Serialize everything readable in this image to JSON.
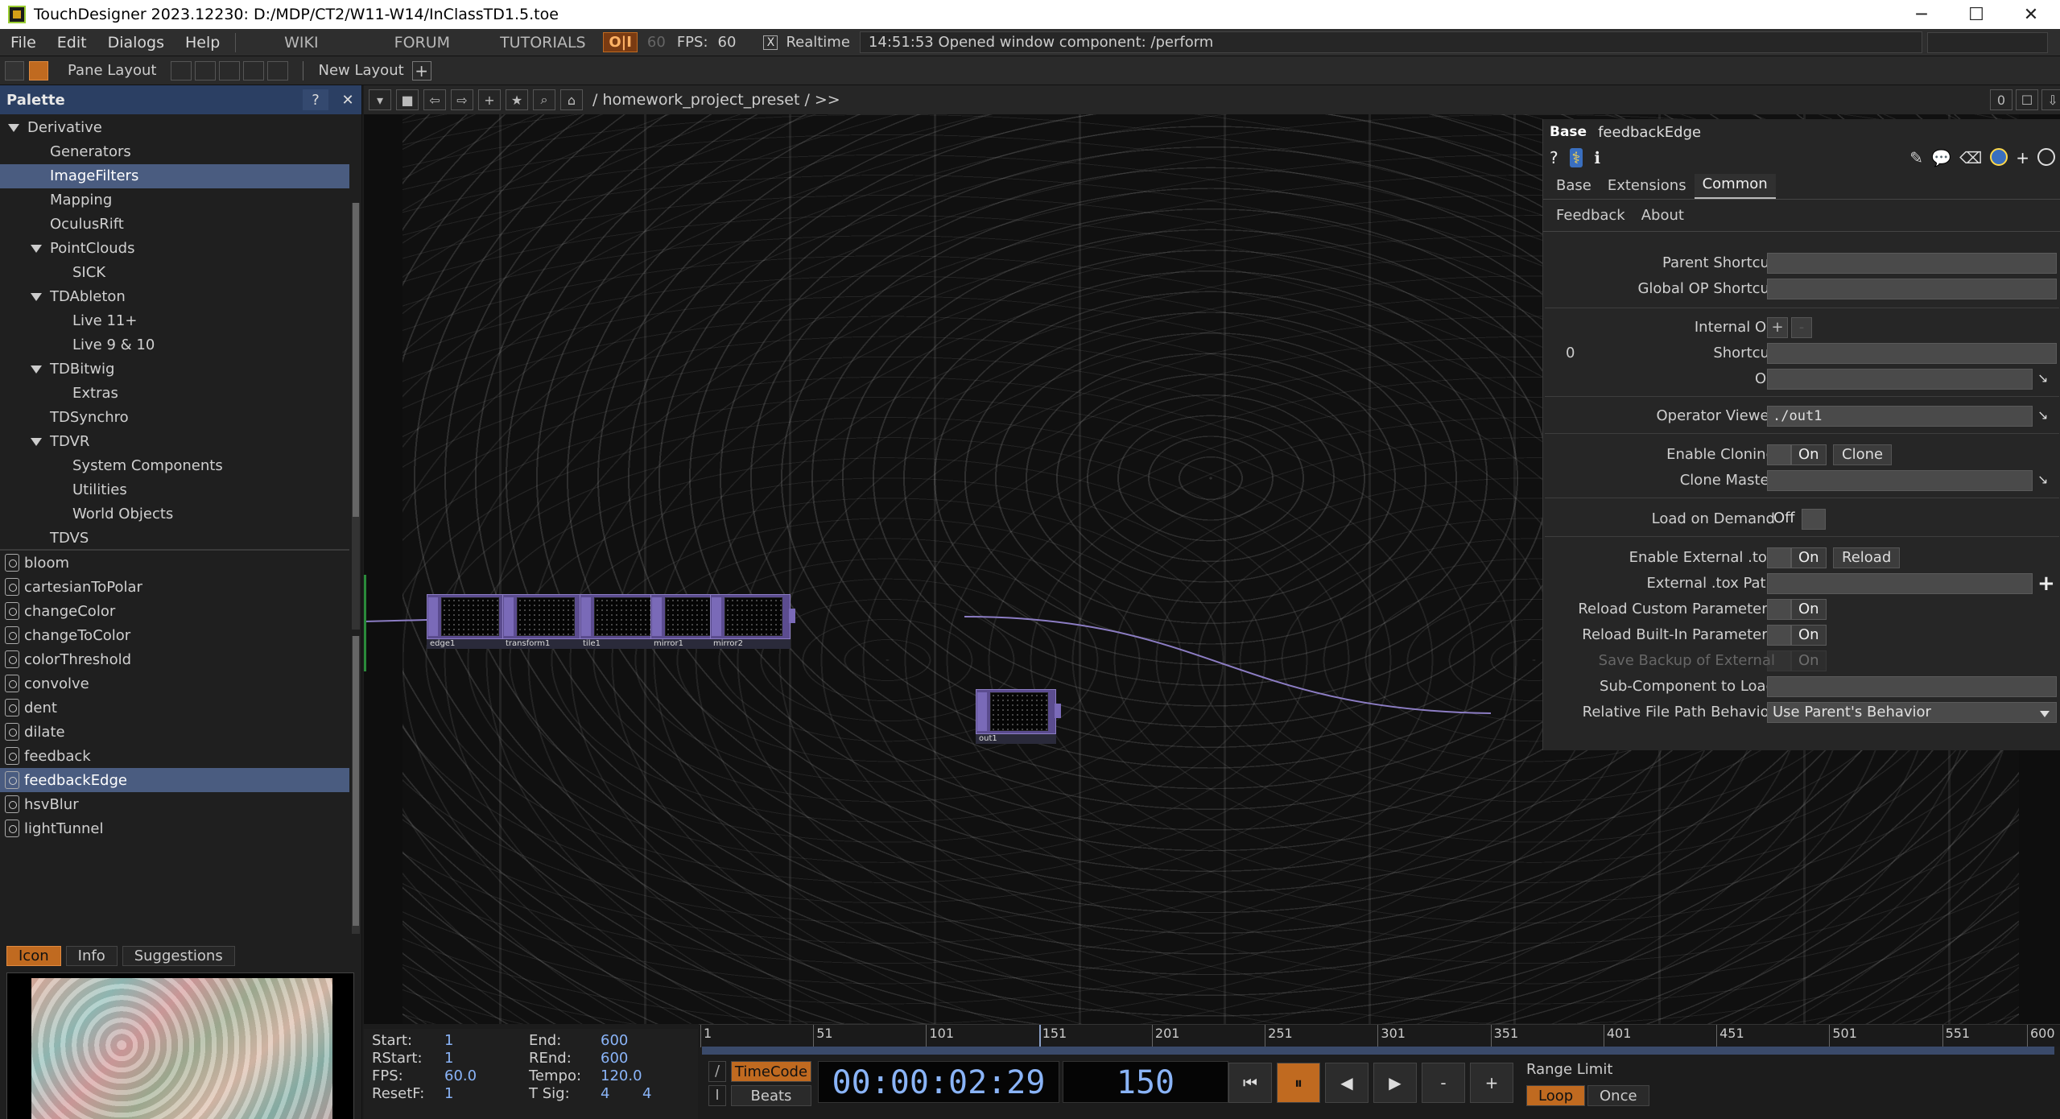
{
  "window": {
    "title": "TouchDesigner 2023.12230: D:/MDP/CT2/W11-W14/InClassTD1.5.toe",
    "minimize": "─",
    "maximize": "☐",
    "close": "✕"
  },
  "menubar": {
    "menus": [
      "File",
      "Edit",
      "Dialogs",
      "Help"
    ],
    "nav": [
      "WIKI",
      "FORUM",
      "TUTORIALS"
    ],
    "oi_label": "O|I",
    "cook_rate": "60",
    "fps_label": "FPS:",
    "fps_value": "60",
    "realtime_check": "X",
    "realtime_label": "Realtime",
    "status_message": "14:51:53 Opened window component: /perform"
  },
  "panebar": {
    "pane_layout_label": "Pane Layout",
    "new_layout_label": "New Layout",
    "add_label": "+"
  },
  "palette": {
    "title": "Palette",
    "help_btn": "?",
    "close_btn": "✕",
    "tree": [
      {
        "label": "Derivative",
        "indent": 0,
        "expanded": true
      },
      {
        "label": "Generators",
        "indent": 1
      },
      {
        "label": "ImageFilters",
        "indent": 1,
        "selected": true
      },
      {
        "label": "Mapping",
        "indent": 1
      },
      {
        "label": "OculusRift",
        "indent": 1
      },
      {
        "label": "PointClouds",
        "indent": 1,
        "expanded": true
      },
      {
        "label": "SICK",
        "indent": 2
      },
      {
        "label": "TDAbleton",
        "indent": 1,
        "expanded": true
      },
      {
        "label": "Live 11+",
        "indent": 2
      },
      {
        "label": "Live 9 & 10",
        "indent": 2
      },
      {
        "label": "TDBitwig",
        "indent": 1,
        "expanded": true
      },
      {
        "label": "Extras",
        "indent": 2
      },
      {
        "label": "TDSynchro",
        "indent": 1
      },
      {
        "label": "TDVR",
        "indent": 1,
        "expanded": true
      },
      {
        "label": "System Components",
        "indent": 2
      },
      {
        "label": "Utilities",
        "indent": 2
      },
      {
        "label": "World Objects",
        "indent": 2
      },
      {
        "label": "TDVS",
        "indent": 1
      }
    ],
    "operators": [
      "bloom",
      "cartesianToPolar",
      "changeColor",
      "changeToColor",
      "colorThreshold",
      "convolve",
      "dent",
      "dilate",
      "feedback",
      "feedbackEdge",
      "hsvBlur",
      "lightTunnel"
    ],
    "selected_operator": "feedbackEdge",
    "preview_tabs": [
      "Icon",
      "Info",
      "Suggestions"
    ],
    "active_preview_tab": "Icon"
  },
  "network": {
    "path": "/ homework_project_preset / >>",
    "counter": "0",
    "nodes": [
      {
        "name": "edge1"
      },
      {
        "name": "transform1"
      },
      {
        "name": "tile1"
      },
      {
        "name": "mirror1"
      },
      {
        "name": "mirror2"
      },
      {
        "name": "out1"
      }
    ]
  },
  "params": {
    "op_type": "Base",
    "op_name": "feedbackEdge",
    "tabs": [
      "Base",
      "Extensions",
      "Common"
    ],
    "active_tab": "Common",
    "subtabs": [
      "Feedback",
      "About"
    ],
    "rows": {
      "parent_shortcut": "Parent Shortcut",
      "global_op_shortcut": "Global OP Shortcut",
      "internal_op": "Internal OP",
      "internal_index": "0",
      "shortcut": "Shortcut",
      "op": "OP",
      "operator_viewer": "Operator Viewer",
      "operator_viewer_value": "./out1",
      "enable_cloning": "Enable Cloning",
      "clone_btn": "Clone",
      "clone_master": "Clone Master",
      "load_on_demand": "Load on Demand",
      "off_label": "Off",
      "on_label": "On",
      "enable_external_tox": "Enable External .tox",
      "reload_btn": "Reload",
      "external_tox_path": "External .tox Path",
      "reload_custom_params": "Reload Custom Parameters",
      "reload_builtin_params": "Reload Built-In Parameters",
      "save_backup": "Save Backup of External",
      "sub_component": "Sub-Component to Load",
      "relative_path_behavior": "Relative File Path Behavior",
      "relative_path_value": "Use Parent's Behavior",
      "add_plus": "+",
      "remove_minus": "-"
    }
  },
  "timeline": {
    "ruler_ticks": [
      "1",
      "51",
      "101",
      "151",
      "201",
      "251",
      "301",
      "351",
      "401",
      "451",
      "501",
      "551",
      "600"
    ],
    "current_frame_fraction": 0.2504,
    "start_label": "Start:",
    "start": "1",
    "end_label": "End:",
    "end": "600",
    "rstart_label": "RStart:",
    "rstart": "1",
    "rend_label": "REnd:",
    "rend": "600",
    "fps_label": "FPS:",
    "fps": "60.0",
    "tempo_label": "Tempo:",
    "tempo": "120.0",
    "resetf_label": "ResetF:",
    "resetf": "1",
    "tsig_label": "T Sig:",
    "tsig_a": "4",
    "tsig_b": "4",
    "timecode_mode": "TimeCode",
    "beats_mode": "Beats",
    "timecode": "00:00:02:29",
    "frame": "150",
    "range_limit_label": "Range Limit",
    "loop_label": "Loop",
    "once_label": "Once",
    "btn_first": "⏮",
    "btn_pause": "⏸",
    "btn_back": "◀",
    "btn_fwd": "▶",
    "btn_minus": "-",
    "btn_plus": "+"
  }
}
